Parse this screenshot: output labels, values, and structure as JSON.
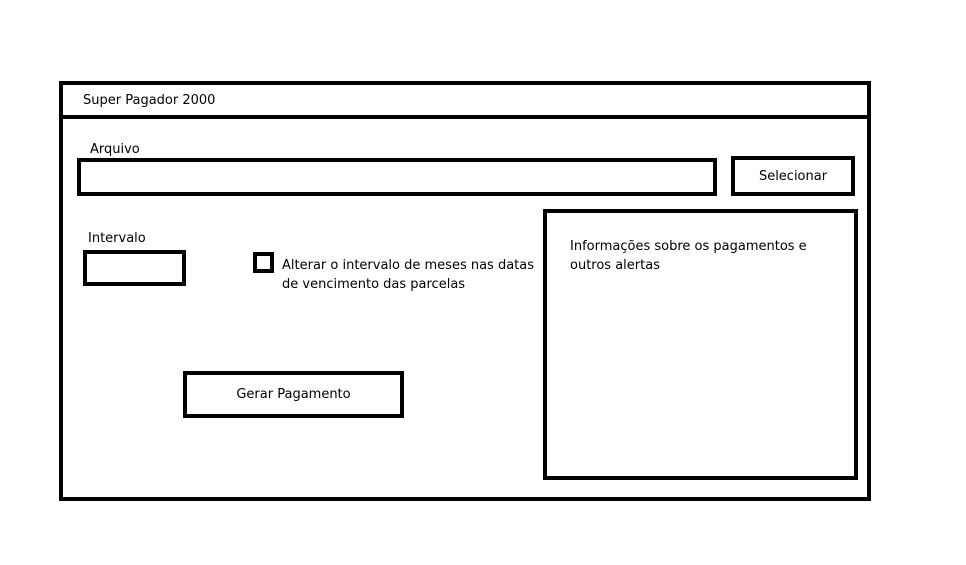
{
  "window": {
    "title": "Super Pagador 2000"
  },
  "file": {
    "label": "Arquivo",
    "value": "",
    "select_button": "Selecionar"
  },
  "interval": {
    "label": "Intervalo",
    "value": ""
  },
  "alter_interval": {
    "checked": false,
    "label": "Alterar o intervalo de meses nas datas de vencimento das parcelas"
  },
  "generate": {
    "button": "Gerar Pagamento"
  },
  "info_panel": {
    "text": "Informações sobre os pagamentos e outros alertas"
  }
}
